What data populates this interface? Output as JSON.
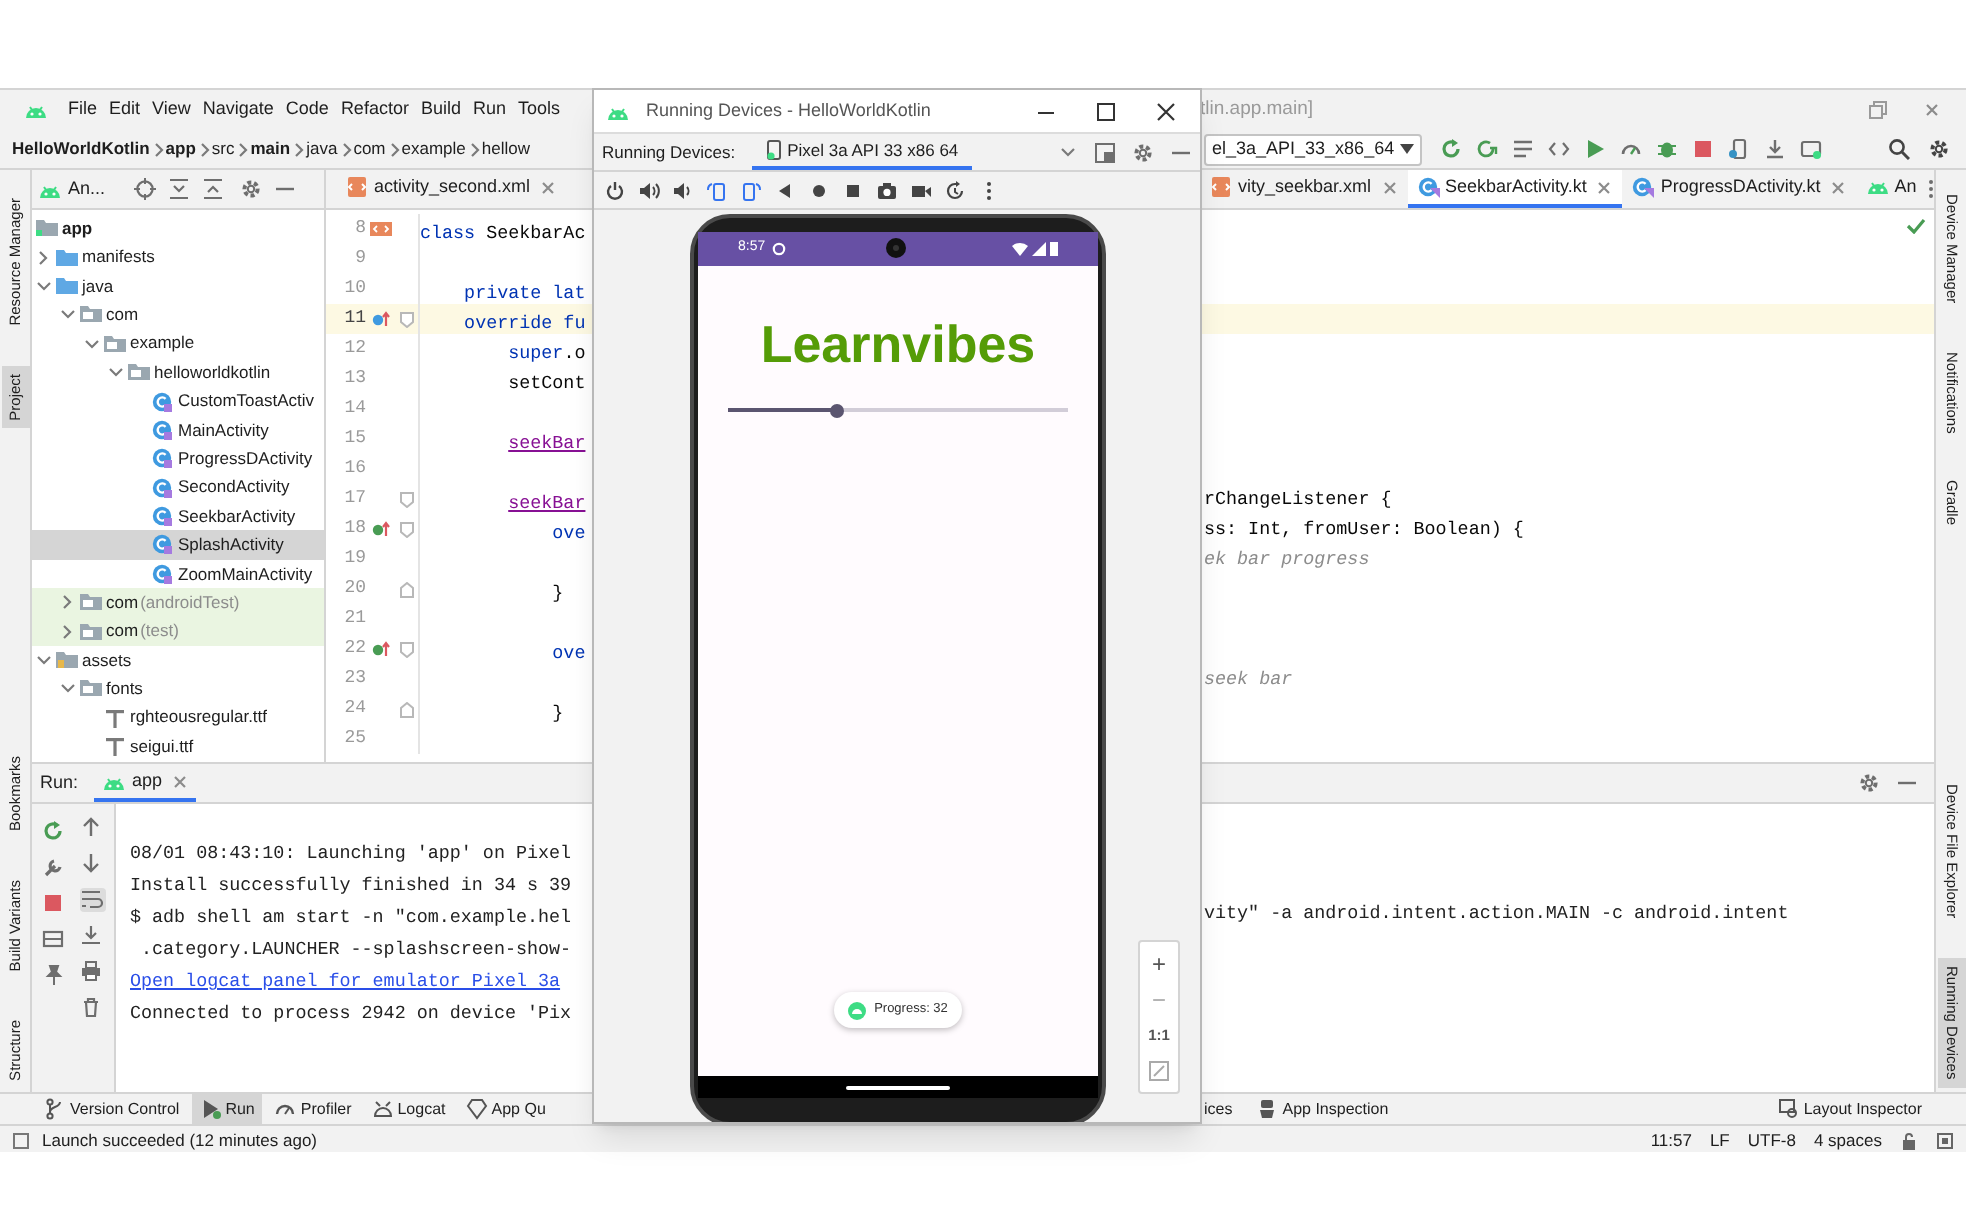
{
  "ide": {
    "title_fragment": "tlin.app.main]",
    "menu": [
      "File",
      "Edit",
      "View",
      "Navigate",
      "Code",
      "Refactor",
      "Build",
      "Run",
      "Tools"
    ],
    "breadcrumb": [
      {
        "label": "HelloWorldKotlin",
        "kind": "root"
      },
      {
        "label": "app",
        "kind": "root"
      },
      {
        "label": "src",
        "kind": "folder"
      },
      {
        "label": "main",
        "kind": "root"
      },
      {
        "label": "java",
        "kind": "folder"
      },
      {
        "label": "com",
        "kind": "folder"
      },
      {
        "label": "example",
        "kind": "folder"
      },
      {
        "label": "hellow",
        "kind": "folder"
      }
    ],
    "run_configuration": "el_3a_API_33_x86_64",
    "left_tool_tabs": {
      "top": [
        {
          "label": "Resource Manager",
          "selected": false
        },
        {
          "label": "Project",
          "selected": true
        }
      ],
      "bottom": [
        {
          "label": "Bookmarks",
          "selected": false
        },
        {
          "label": "Build Variants",
          "selected": false
        },
        {
          "label": "Structure",
          "selected": false
        }
      ]
    },
    "right_tool_tabs": {
      "top": [
        {
          "label": "Device Manager",
          "selected": false
        },
        {
          "label": "Notifications",
          "selected": false
        },
        {
          "label": "Gradle",
          "selected": false
        }
      ],
      "bottom": [
        {
          "label": "Device File Explorer",
          "selected": false
        },
        {
          "label": "Running Devices",
          "selected": true
        }
      ]
    },
    "project_panel": {
      "title": "An...",
      "tree": [
        {
          "label": "app",
          "kind": "module",
          "selected": false,
          "children": [
            {
              "label": "manifests",
              "kind": "source_folder",
              "selected": false,
              "expanded": false
            },
            {
              "label": "java",
              "kind": "source_folder",
              "selected": false,
              "expanded": true,
              "children": [
                {
                  "label": "com",
                  "kind": "package",
                  "selected": false,
                  "expanded": true,
                  "children": [
                    {
                      "label": "example",
                      "kind": "package",
                      "selected": false,
                      "expanded": true,
                      "children": [
                        {
                          "label": "helloworldkotlin",
                          "kind": "package",
                          "selected": false,
                          "expanded": true,
                          "children": [
                            {
                              "label": "CustomToastActiv",
                              "kind": "class",
                              "selected": false
                            },
                            {
                              "label": "MainActivity",
                              "kind": "class",
                              "selected": false
                            },
                            {
                              "label": "ProgressDActivity",
                              "kind": "class",
                              "selected": false
                            },
                            {
                              "label": "SecondActivity",
                              "kind": "class",
                              "selected": false
                            },
                            {
                              "label": "SeekbarActivity",
                              "kind": "class",
                              "selected": false
                            },
                            {
                              "label": "SplashActivity",
                              "kind": "class",
                              "selected": true
                            },
                            {
                              "label": "ZoomMainActivity",
                              "kind": "class",
                              "selected": false
                            }
                          ]
                        }
                      ]
                    }
                  ]
                },
                {
                  "label": "com",
                  "suffix": "(androidTest)",
                  "kind": "test_package",
                  "selected": false,
                  "expanded": false
                },
                {
                  "label": "com",
                  "suffix": "(test)",
                  "kind": "test_package",
                  "selected": false,
                  "expanded": false
                }
              ]
            },
            {
              "label": "assets",
              "kind": "resource_folder",
              "selected": false,
              "expanded": true,
              "children": [
                {
                  "label": "fonts",
                  "kind": "package",
                  "selected": false,
                  "expanded": true,
                  "children": [
                    {
                      "label": "rghteousregular.ttf",
                      "kind": "font",
                      "selected": false
                    },
                    {
                      "label": "seigui.ttf",
                      "kind": "font",
                      "selected": false
                    }
                  ]
                }
              ]
            }
          ]
        }
      ]
    },
    "editor_tabs": {
      "before_window": [
        {
          "label": "activity_second.xml",
          "kind": "xml",
          "selected": false
        }
      ],
      "after_window": [
        {
          "label": "vity_seekbar.xml",
          "kind": "xml",
          "selected": false
        },
        {
          "label": "SeekbarActivity.kt",
          "kind": "kotlin",
          "selected": true
        },
        {
          "label": "ProgressDActivity.kt",
          "kind": "kotlin",
          "selected": false
        },
        {
          "label": "An",
          "kind": "android",
          "selected": false
        }
      ]
    },
    "code_lines": [
      {
        "number": "8",
        "current": false,
        "gutter": [
          {
            "kind": "class"
          }
        ],
        "left": [
          {
            "text": "class",
            "kind": "keyword"
          },
          {
            "text": " SeekbarAc",
            "kind": "plain"
          }
        ]
      },
      {
        "number": "9",
        "current": false
      },
      {
        "number": "10",
        "current": false,
        "left": [
          {
            "text": "    private lat",
            "kind": "keyword"
          }
        ]
      },
      {
        "number": "11",
        "current": true,
        "gutter": [
          {
            "kind": "override"
          },
          {
            "kind": "fold_start"
          }
        ],
        "left": [
          {
            "text": "    override fu",
            "kind": "keyword"
          }
        ]
      },
      {
        "number": "12",
        "current": false,
        "left": [
          {
            "text": "        super",
            "kind": "keyword"
          },
          {
            "text": ".o",
            "kind": "plain"
          }
        ]
      },
      {
        "number": "13",
        "current": false,
        "left": [
          {
            "text": "        setCont",
            "kind": "plain"
          }
        ]
      },
      {
        "number": "14",
        "current": false
      },
      {
        "number": "15",
        "current": false,
        "left": [
          {
            "text": "        seekBar",
            "kind": "property"
          }
        ]
      },
      {
        "number": "16",
        "current": false
      },
      {
        "number": "17",
        "current": false,
        "gutter": [
          {
            "kind": "fold_start"
          }
        ],
        "left": [
          {
            "text": "        seekBar",
            "kind": "property"
          }
        ],
        "right": [
          {
            "text": "rChangeListener {",
            "kind": "plain"
          }
        ]
      },
      {
        "number": "18",
        "current": false,
        "gutter": [
          {
            "kind": "override"
          },
          {
            "kind": "fold_start"
          }
        ],
        "left": [
          {
            "text": "            ove",
            "kind": "keyword"
          }
        ],
        "right": [
          {
            "text": "ss: Int, fromUser: Boolean) {",
            "kind": "plain"
          }
        ]
      },
      {
        "number": "19",
        "current": false,
        "right": [
          {
            "text": "ek bar progress",
            "kind": "comment"
          }
        ]
      },
      {
        "number": "20",
        "current": false,
        "gutter": [
          {
            "kind": "fold_end"
          }
        ],
        "left": [
          {
            "text": "            }",
            "kind": "plain"
          }
        ]
      },
      {
        "number": "21",
        "current": false
      },
      {
        "number": "22",
        "current": false,
        "gutter": [
          {
            "kind": "override"
          },
          {
            "kind": "fold_start"
          }
        ],
        "left": [
          {
            "text": "            ove",
            "kind": "keyword"
          }
        ]
      },
      {
        "number": "23",
        "current": false,
        "right": [
          {
            "text": "seek bar",
            "kind": "comment"
          }
        ]
      },
      {
        "number": "24",
        "current": false,
        "gutter": [
          {
            "kind": "fold_end"
          }
        ],
        "left": [
          {
            "text": "            }",
            "kind": "plain"
          }
        ]
      },
      {
        "number": "25",
        "current": false
      }
    ],
    "run_panel": {
      "label": "Run:",
      "tabs": [
        {
          "label": "app",
          "selected": true
        }
      ],
      "console": [
        {
          "kind": "text",
          "left": "08/01 08:43:10: Launching 'app' on Pixel"
        },
        {
          "kind": "text",
          "left": "Install successfully finished in 34 s 39"
        },
        {
          "kind": "text",
          "left": "$ adb shell am start -n \"com.example.hel",
          "right": "vity\" -a android.intent.action.MAIN -c android.intent"
        },
        {
          "kind": "text",
          "left": " .category.LAUNCHER --splashscreen-show-"
        },
        {
          "kind": "link",
          "left": "Open logcat panel for emulator Pixel 3a"
        },
        {
          "kind": "text",
          "left": "Connected to process 2942 on device 'Pix"
        }
      ]
    },
    "bottom_tabs": {
      "before_window": [
        {
          "label": "Version Control",
          "selected": false
        },
        {
          "label": "Run",
          "selected": true
        },
        {
          "label": "Profiler",
          "selected": false
        },
        {
          "label": "Logcat",
          "selected": false
        },
        {
          "label": "App Qu",
          "selected": false
        }
      ],
      "after_window": [
        {
          "label": "ices",
          "selected": false
        },
        {
          "label": "App Inspection",
          "selected": false
        }
      ],
      "right": [
        {
          "label": "Layout Inspector",
          "selected": false
        }
      ]
    },
    "status_bar": {
      "message": "Launch succeeded (12 minutes ago)",
      "items": [
        "11:57",
        "LF",
        "UTF-8",
        "4 spaces"
      ]
    }
  },
  "emulator_window": {
    "title": "Running Devices - HelloWorldKotlin",
    "label": "Running Devices:",
    "tabs": [
      {
        "label": "Pixel 3a API 33 x86 64",
        "selected": true
      }
    ],
    "phone": {
      "time": "8:57",
      "app_title": "Learnvibes",
      "seekbar": {
        "level": 0.32
      },
      "toast": "Progress: 32"
    },
    "zoom_controls": {
      "zoom_in": "+",
      "zoom_out": "−",
      "actual_size": "1:1"
    }
  }
}
